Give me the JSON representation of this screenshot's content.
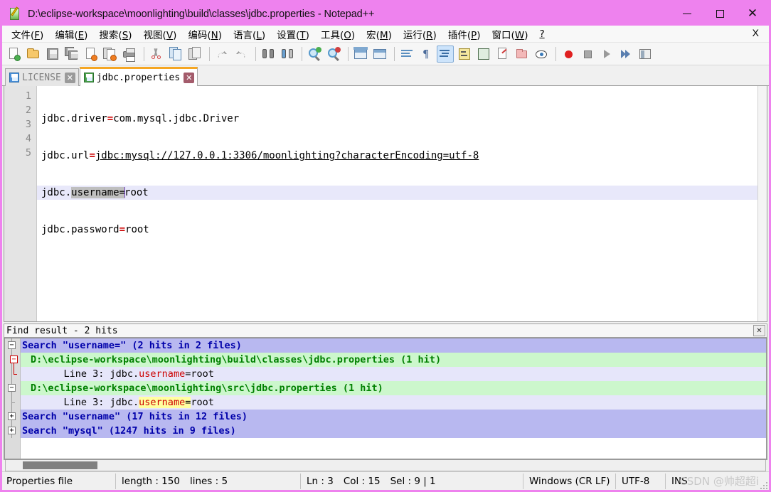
{
  "window": {
    "title": "D:\\eclipse-workspace\\moonlighting\\build\\classes\\jdbc.properties - Notepad++",
    "minimize_label": "Minimize",
    "maximize_label": "Maximize",
    "close_label": "Close",
    "titlebar_color": "#ee82ee"
  },
  "menubar": {
    "items": [
      {
        "label": "文件(F)",
        "text": "文件",
        "accel": "F"
      },
      {
        "label": "编辑(E)",
        "text": "编辑",
        "accel": "E"
      },
      {
        "label": "搜索(S)",
        "text": "搜索",
        "accel": "S"
      },
      {
        "label": "视图(V)",
        "text": "视图",
        "accel": "V"
      },
      {
        "label": "编码(N)",
        "text": "编码",
        "accel": "N"
      },
      {
        "label": "语言(L)",
        "text": "语言",
        "accel": "L"
      },
      {
        "label": "设置(T)",
        "text": "设置",
        "accel": "T"
      },
      {
        "label": "工具(O)",
        "text": "工具",
        "accel": "O"
      },
      {
        "label": "宏(M)",
        "text": "宏",
        "accel": "M"
      },
      {
        "label": "运行(R)",
        "text": "运行",
        "accel": "R"
      },
      {
        "label": "插件(P)",
        "text": "插件",
        "accel": "P"
      },
      {
        "label": "窗口(W)",
        "text": "窗口",
        "accel": "W"
      },
      {
        "label": "?",
        "text": "?",
        "accel": ""
      }
    ],
    "close_document_label": "X"
  },
  "toolbar": {
    "buttons": [
      {
        "name": "new-file-icon",
        "tip": "新建"
      },
      {
        "name": "open-file-icon",
        "tip": "打开"
      },
      {
        "name": "save-icon",
        "tip": "保存"
      },
      {
        "name": "save-all-icon",
        "tip": "保存所有"
      },
      {
        "name": "close-file-icon",
        "tip": "关闭"
      },
      {
        "name": "close-all-files-icon",
        "tip": "关闭所有"
      },
      {
        "name": "print-icon",
        "tip": "打印"
      },
      {
        "name": "cut-icon",
        "tip": "剪切"
      },
      {
        "name": "copy-icon",
        "tip": "复制"
      },
      {
        "name": "paste-icon",
        "tip": "粘贴"
      },
      {
        "name": "undo-icon",
        "tip": "撤销"
      },
      {
        "name": "redo-icon",
        "tip": "重做"
      },
      {
        "name": "find-icon",
        "tip": "查找"
      },
      {
        "name": "replace-icon",
        "tip": "替换"
      },
      {
        "name": "zoom-in-icon",
        "tip": "放大"
      },
      {
        "name": "zoom-out-icon",
        "tip": "缩小"
      },
      {
        "name": "sync-vertical-scroll-icon",
        "tip": "同步垂直滚动"
      },
      {
        "name": "sync-horizontal-scroll-icon",
        "tip": "同步水平滚动"
      },
      {
        "name": "word-wrap-icon",
        "tip": "自动换行"
      },
      {
        "name": "show-all-chars-icon",
        "tip": "显示所有字符"
      },
      {
        "name": "indent-guide-icon",
        "tip": "显示缩进参考线"
      },
      {
        "name": "user-define-dialog-icon",
        "tip": "用户自定义语言"
      },
      {
        "name": "document-map-icon",
        "tip": "文档地图"
      },
      {
        "name": "function-list-icon",
        "tip": "函数列表"
      },
      {
        "name": "folder-as-workspace-icon",
        "tip": "文件夹作为工作区"
      },
      {
        "name": "monitoring-icon",
        "tip": "监视文件"
      },
      {
        "name": "record-macro-icon",
        "tip": "开始录制宏"
      },
      {
        "name": "stop-macro-icon",
        "tip": "停止录制宏"
      },
      {
        "name": "play-macro-icon",
        "tip": "播放宏"
      },
      {
        "name": "run-macro-multiple-icon",
        "tip": "多次运行宏"
      },
      {
        "name": "save-macro-icon",
        "tip": "保存当前录制的宏"
      }
    ]
  },
  "tabs": [
    {
      "label": "LICENSE",
      "active": false,
      "saved": true
    },
    {
      "label": "jdbc.properties",
      "active": true,
      "saved": true
    }
  ],
  "editor": {
    "line_numbers": [
      "1",
      "2",
      "3",
      "4",
      "5"
    ],
    "lines": [
      {
        "n": 1,
        "prefix": "jdbc.driver",
        "eq": "=",
        "suffix": "com.mysql.jdbc.Driver",
        "current": false
      },
      {
        "n": 2,
        "prefix": "jdbc.url",
        "eq": "=",
        "suffix": "jdbc:mysql://127.0.0.1:3306/moonlighting?characterEncoding=utf-8",
        "current": false
      },
      {
        "n": 3,
        "prefix": "jdbc.",
        "selected": "username=",
        "suffix": "root",
        "current": true
      },
      {
        "n": 4,
        "prefix": "jdbc.password",
        "eq": "=",
        "suffix": "root",
        "current": false
      },
      {
        "n": 5,
        "prefix": "",
        "eq": "",
        "suffix": "",
        "current": false
      }
    ]
  },
  "find_result": {
    "header": "Find result - 2 hits",
    "close_label": "✕",
    "rows": [
      {
        "type": "search",
        "node": "minus",
        "text": "Search \"username=\" (2 hits in 2 files)"
      },
      {
        "type": "file",
        "node": "minus-red",
        "text": "D:\\eclipse-workspace\\moonlighting\\build\\classes\\jdbc.properties (1 hit)"
      },
      {
        "type": "hit",
        "node": "tick-red",
        "pre": "    Line 3: jdbc.",
        "match": "username",
        "eq": "=",
        "post": "root",
        "highlight": false
      },
      {
        "type": "file",
        "node": "minus",
        "text": "D:\\eclipse-workspace\\moonlighting\\src\\jdbc.properties (1 hit)"
      },
      {
        "type": "hit",
        "node": "tick",
        "pre": "    Line 3: jdbc.",
        "match": "username",
        "eq": "=",
        "post": "root",
        "highlight": true
      },
      {
        "type": "search",
        "node": "plus",
        "text": "Search \"username\" (17 hits in 12 files)"
      },
      {
        "type": "search",
        "node": "plus",
        "text": "Search \"mysql\" (1247 hits in 9 files)"
      }
    ]
  },
  "statusbar": {
    "language": "Properties file",
    "length": "length : 150",
    "lines": "lines : 5",
    "ln": "Ln : 3",
    "col": "Col : 15",
    "sel": "Sel : 9 | 1",
    "eol": "Windows (CR LF)",
    "encoding": "UTF-8",
    "insert_mode": "INS",
    "watermark": "CSDN @帅超超i"
  }
}
